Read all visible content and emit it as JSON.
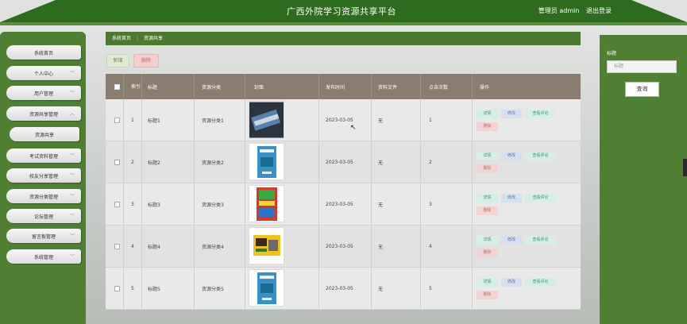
{
  "header": {
    "site_title": "广西外院学习资源共享平台",
    "user_label": "管理员 admin",
    "logout": "退出登录"
  },
  "sidebar": {
    "items": [
      {
        "label": "系统首页",
        "chevron": false
      },
      {
        "label": "个人中心",
        "chevron": true
      },
      {
        "label": "用户管理",
        "chevron": true
      },
      {
        "label": "资源共享管理",
        "chevron": true,
        "expanded": true
      },
      {
        "label": "资源共享",
        "chevron": false,
        "sub": true
      },
      {
        "label": "考试资料管理",
        "chevron": true
      },
      {
        "label": "校友分享管理",
        "chevron": true
      },
      {
        "label": "资源分类管理",
        "chevron": true
      },
      {
        "label": "论坛管理",
        "chevron": true
      },
      {
        "label": "留言板管理",
        "chevron": true
      },
      {
        "label": "系统管理",
        "chevron": true
      }
    ]
  },
  "breadcrumb": {
    "home": "系统首页",
    "separator": "⋮",
    "current": "资源共享"
  },
  "actions": {
    "new_label": "新增",
    "delete_label": "删除"
  },
  "search": {
    "label": "标题",
    "placeholder": "标题",
    "button": "查询"
  },
  "table": {
    "columns": [
      "",
      "索引",
      "标题",
      "资源分类",
      "封面",
      "发布时间",
      "资料文件",
      "点击次数",
      "操作"
    ],
    "column_sub": "引",
    "row_actions": {
      "detail": "详情",
      "edit": "修改",
      "comments": "查看评论",
      "delete": "删除"
    },
    "rows": [
      {
        "index": "1",
        "title": "标题1",
        "category": "资源分类1",
        "date": "2023-03-05",
        "file": "无",
        "clicks": "1",
        "cover": "photo-book-stack"
      },
      {
        "index": "2",
        "title": "标题2",
        "category": "资源分类2",
        "date": "2023-03-05",
        "file": "无",
        "clicks": "2",
        "cover": "blue-book"
      },
      {
        "index": "3",
        "title": "标题3",
        "category": "资源分类3",
        "date": "2023-03-05",
        "file": "无",
        "clicks": "3",
        "cover": "red-exam-book"
      },
      {
        "index": "4",
        "title": "标题4",
        "category": "资源分类4",
        "date": "2023-03-05",
        "file": "无",
        "clicks": "4",
        "cover": "yellow-device-book"
      },
      {
        "index": "5",
        "title": "标题5",
        "category": "资源分类5",
        "date": "2023-03-05",
        "file": "无",
        "clicks": "5",
        "cover": "blue-book"
      }
    ]
  },
  "colors": {
    "primary_green": "#4f7f33",
    "header_green": "#2f6b1e",
    "table_header": "#8a7c6e"
  }
}
